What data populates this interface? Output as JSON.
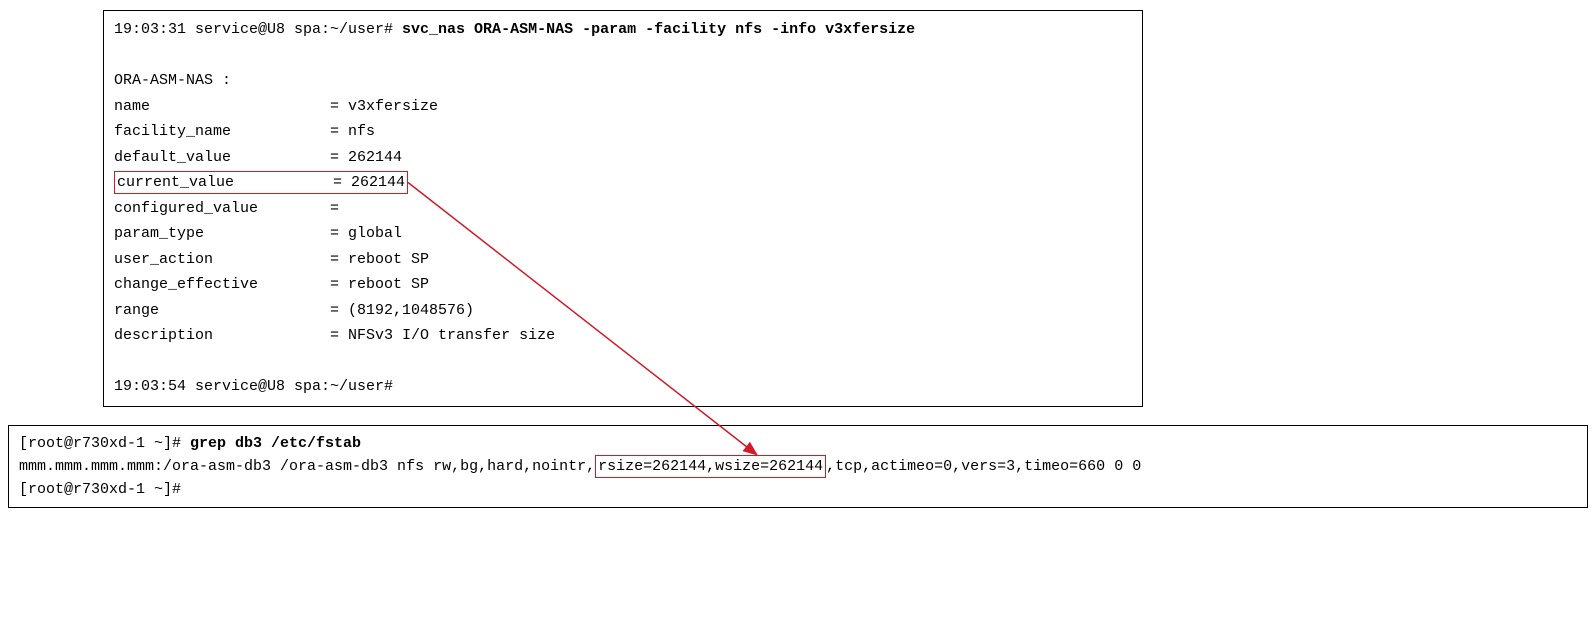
{
  "top": {
    "prompt_prefix": "19:03:31 service@U8 spa:~/user# ",
    "command": "svc_nas ORA-ASM-NAS -param -facility nfs -info v3xfersize",
    "section_header": "ORA-ASM-NAS :",
    "rows": {
      "name": "name                    = v3xfersize",
      "facility_name": "facility_name           = nfs",
      "default_value": "default_value           = 262144",
      "current_value": "current_value           = 262144",
      "configured_value": "configured_value        =",
      "param_type": "param_type              = global",
      "user_action": "user_action             = reboot SP",
      "change_effective": "change_effective        = reboot SP",
      "range": "range                   = (8192,1048576)",
      "description": "description             = NFSv3 I/O transfer size"
    },
    "prompt_end": "19:03:54 service@U8 spa:~/user#"
  },
  "bottom": {
    "prompt_prefix": "[root@r730xd-1 ~]# ",
    "command": "grep db3 /etc/fstab",
    "line_pre": "mmm.mmm.mmm.mmm:/ora-asm-db3 /ora-asm-db3 nfs rw,bg,hard,nointr,",
    "hl": "rsize=262144,wsize=262144",
    "line_post": ",tcp,actimeo=0,vers=3,timeo=660 0 0",
    "prompt_end": "[root@r730xd-1 ~]#"
  }
}
